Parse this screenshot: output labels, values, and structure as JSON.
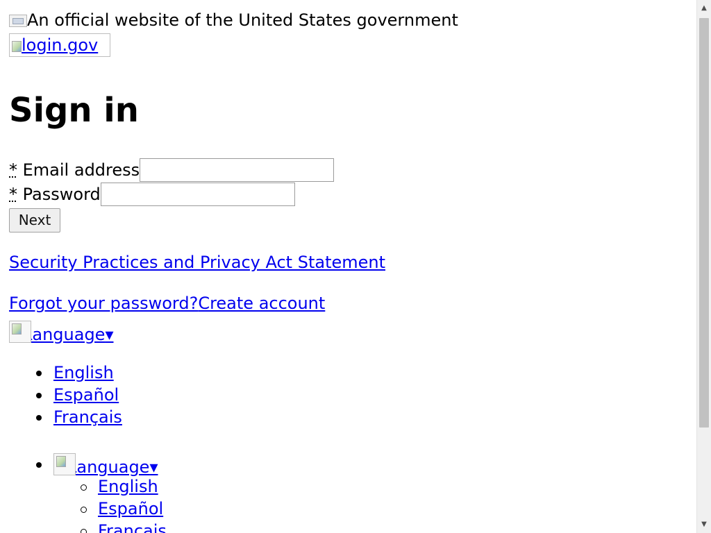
{
  "banner": {
    "text": "An official website of the United States government",
    "flag_icon": "us-flag-icon"
  },
  "logo": {
    "alt_text": "login.gov"
  },
  "page_title": "Sign in",
  "form": {
    "required_marker": "*",
    "email_label": "Email address",
    "email_value": "",
    "password_label": "Password",
    "password_value": "",
    "submit_label": "Next"
  },
  "links": {
    "privacy": "Security Practices and Privacy Act Statement",
    "forgot_password": "Forgot your password?",
    "create_account": "Create account"
  },
  "language_menu_1": {
    "toggle_label": "Language",
    "arrow": "▾",
    "options": [
      "English",
      "Español",
      "Français"
    ]
  },
  "language_menu_2": {
    "toggle_label": "Language",
    "arrow": "▾",
    "options": [
      "English",
      "Español",
      "Français"
    ]
  },
  "colors": {
    "link": "#0000ee",
    "text": "#000000",
    "background": "#ffffff"
  }
}
